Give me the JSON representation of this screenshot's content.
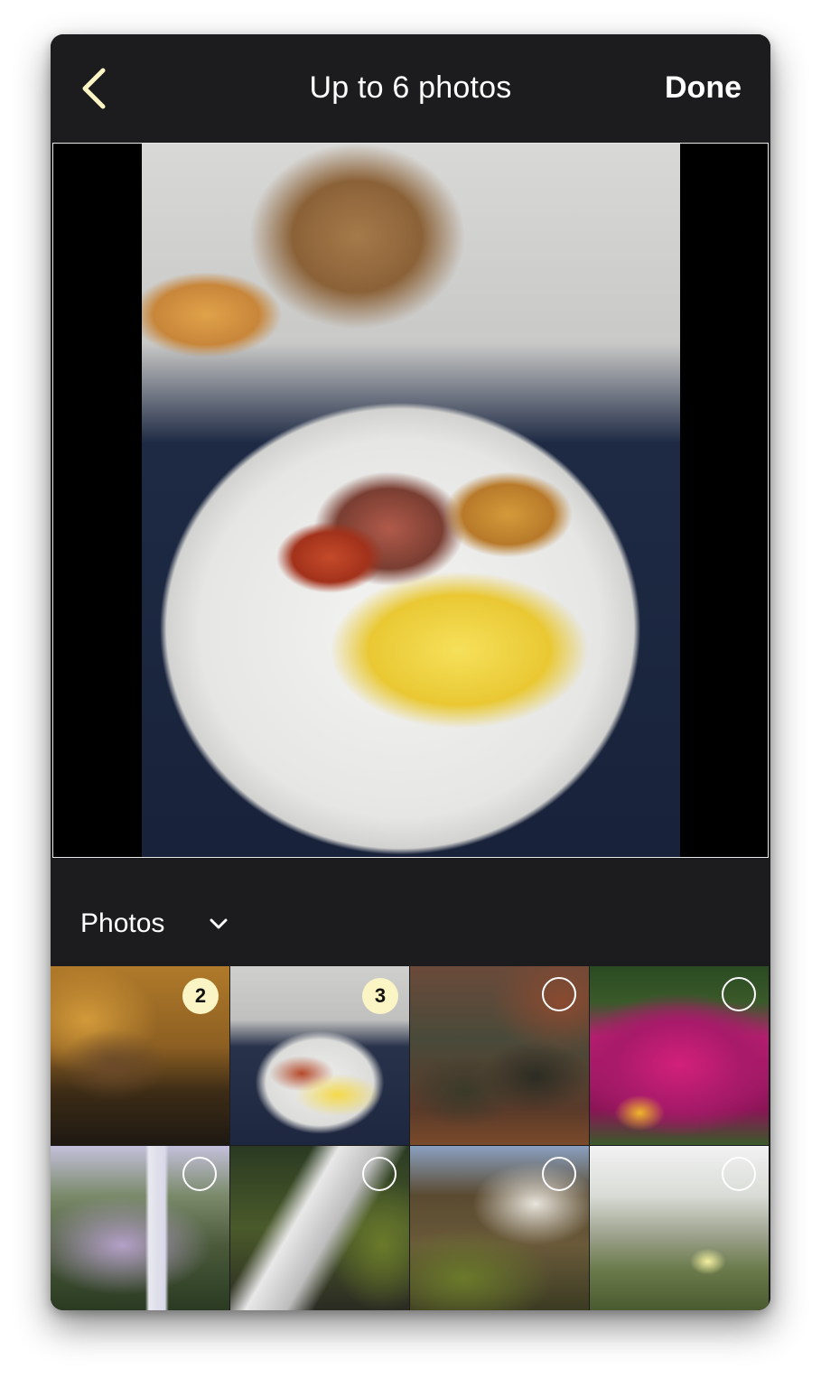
{
  "header": {
    "title": "Up to 6 photos",
    "done_label": "Done",
    "back_icon": "chevron-left-icon"
  },
  "preview": {
    "description_icon": "selected-photo-preview"
  },
  "album": {
    "label": "Photos",
    "chevron_icon": "chevron-down-icon"
  },
  "grid": {
    "items": [
      {
        "name": "autumn-cabin",
        "selected": true,
        "order": "2"
      },
      {
        "name": "breakfast-plate",
        "selected": true,
        "order": "3"
      },
      {
        "name": "boots",
        "selected": false,
        "order": ""
      },
      {
        "name": "pink-flowers",
        "selected": false,
        "order": ""
      },
      {
        "name": "waterfall-misty",
        "selected": false,
        "order": ""
      },
      {
        "name": "waterfall-longexposure",
        "selected": false,
        "order": ""
      },
      {
        "name": "waterfall-cliff",
        "selected": false,
        "order": ""
      },
      {
        "name": "dune-grass",
        "selected": false,
        "order": ""
      }
    ]
  },
  "colors": {
    "background": "#1c1c1e",
    "text": "#ffffff",
    "accent": "#fbf4c4"
  }
}
